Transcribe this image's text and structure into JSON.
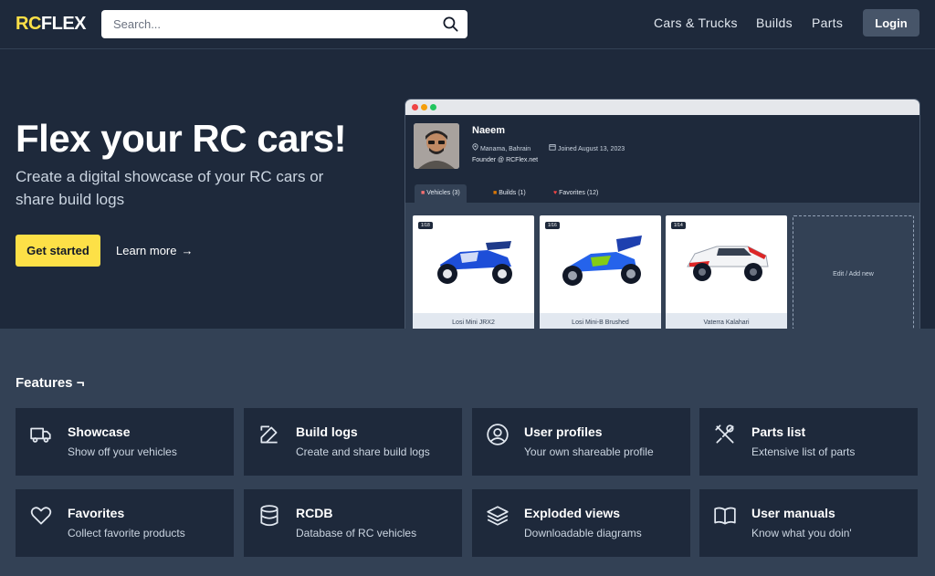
{
  "brand": {
    "logo_part1": "RC",
    "logo_part2": "FLEX"
  },
  "search": {
    "placeholder": "Search..."
  },
  "nav": {
    "cars_trucks": "Cars & Trucks",
    "builds": "Builds",
    "parts": "Parts",
    "login": "Login"
  },
  "hero": {
    "title": "Flex your RC cars!",
    "subtitle": "Create a digital showcase of your RC cars or share build logs",
    "cta": "Get started",
    "learn_more": "Learn more",
    "learn_more_arrow": "→"
  },
  "preview": {
    "profile": {
      "name": "Naeem",
      "location": "Manama, Bahrain",
      "joined": "Joined August 13, 2023",
      "role": "Founder @ RCFlex.net"
    },
    "tabs": [
      {
        "label": "Vehicles (3)",
        "icon": "car-icon"
      },
      {
        "label": "Builds (1)",
        "icon": "box-icon"
      },
      {
        "label": "Favorites (12)",
        "icon": "heart-icon"
      }
    ],
    "vehicles": [
      {
        "scale": "1/18",
        "name": "Losi Mini JRX2",
        "color": "#1d4ed8"
      },
      {
        "scale": "1/16",
        "name": "Losi Mini-B Brushed",
        "color": "#2563eb"
      },
      {
        "scale": "1/14",
        "name": "Vaterra Kalahari",
        "color": "#dc2626"
      }
    ],
    "add_new": "Edit / Add new"
  },
  "features": {
    "title": "Features ¬",
    "items": [
      {
        "title": "Showcase",
        "desc": "Show off your vehicles",
        "icon": "truck-icon"
      },
      {
        "title": "Build logs",
        "desc": "Create and share build logs",
        "icon": "pencil-icon"
      },
      {
        "title": "User profiles",
        "desc": "Your own shareable profile",
        "icon": "user-circle-icon"
      },
      {
        "title": "Parts list",
        "desc": "Extensive list of parts",
        "icon": "tools-icon"
      },
      {
        "title": "Favorites",
        "desc": "Collect favorite products",
        "icon": "heart-icon"
      },
      {
        "title": "RCDB",
        "desc": "Database of RC vehicles",
        "icon": "database-icon"
      },
      {
        "title": "Exploded views",
        "desc": "Downloadable diagrams",
        "icon": "layers-icon"
      },
      {
        "title": "User manuals",
        "desc": "Know what you doin'",
        "icon": "book-icon"
      }
    ]
  },
  "colors": {
    "accent": "#fde047",
    "bg_dark": "#1e293b",
    "bg_mid": "#334155"
  }
}
